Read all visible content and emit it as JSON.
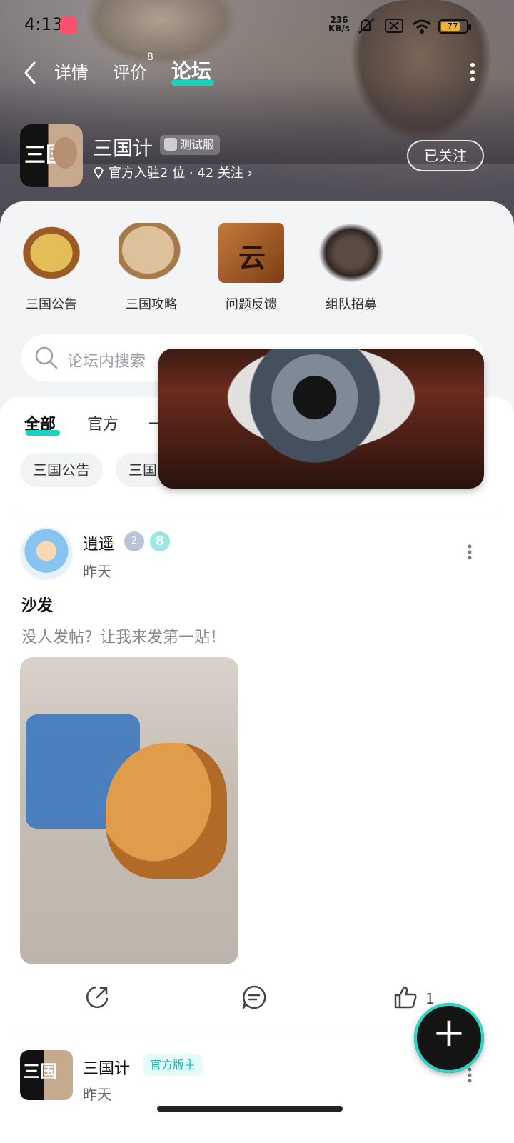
{
  "status_bar": {
    "time": "4:13",
    "net_rate_value": "236",
    "net_rate_unit": "KB/s",
    "battery": "77"
  },
  "nav": {
    "tabs": [
      {
        "label": "详情"
      },
      {
        "label": "评价"
      },
      {
        "label": "论坛"
      }
    ],
    "review_count": "8",
    "active_tab": "论坛"
  },
  "game": {
    "title": "三国计",
    "badge": "测试服",
    "icon_char": "三国",
    "meta": "官方入驻2 位 · 42 关注 ›",
    "follow_label": "已关注"
  },
  "quick_links": [
    {
      "label": "三国公告",
      "icon": "scroll-icon"
    },
    {
      "label": "三国攻略",
      "icon": "map-icon"
    },
    {
      "label": "问题反馈",
      "icon": "feedback-icon",
      "glyph": "云"
    },
    {
      "label": "组队招募",
      "icon": "team-icon"
    }
  ],
  "search": {
    "placeholder": "论坛内搜索"
  },
  "filters": {
    "tabs": [
      "全部",
      "官方",
      "一"
    ],
    "chips": [
      "三国公告",
      "三国"
    ]
  },
  "post1": {
    "user": "逍遥",
    "level_a": "2",
    "level_b": "8",
    "time": "昨天",
    "title": "沙发",
    "body": "没人发帖？让我来发第一贴！",
    "likes": "1"
  },
  "post2": {
    "user": "三国计",
    "badge": "官方版主",
    "time": "昨天"
  },
  "colors": {
    "accent": "#19d3c2"
  }
}
